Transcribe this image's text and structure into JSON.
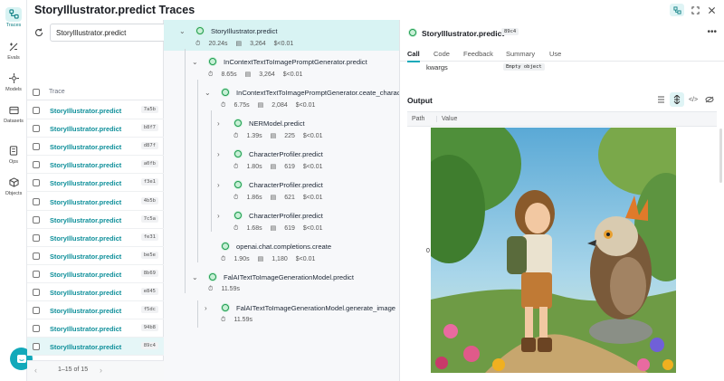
{
  "nav": [
    {
      "label": "Traces",
      "icon": "traces-icon"
    },
    {
      "label": "Evals",
      "icon": "evals-icon"
    },
    {
      "label": "Models",
      "icon": "models-icon"
    },
    {
      "label": "Datasets",
      "icon": "datasets-icon"
    },
    {
      "label": "Ops",
      "icon": "ops-icon"
    },
    {
      "label": "Objects",
      "icon": "objects-icon"
    }
  ],
  "page_title": "StoryIllustrator.predict Traces",
  "search_value": "StoryIllustrator.predict",
  "list_header": "Trace",
  "traces": [
    {
      "name": "StoryIllustrator.predict",
      "id": "7a5b"
    },
    {
      "name": "StoryIllustrator.predict",
      "id": "b8f7"
    },
    {
      "name": "StoryIllustrator.predict",
      "id": "d87f"
    },
    {
      "name": "StoryIllustrator.predict",
      "id": "a0fb"
    },
    {
      "name": "StoryIllustrator.predict",
      "id": "f3e1"
    },
    {
      "name": "StoryIllustrator.predict",
      "id": "4b5b"
    },
    {
      "name": "StoryIllustrator.predict",
      "id": "7c5a"
    },
    {
      "name": "StoryIllustrator.predict",
      "id": "fe31"
    },
    {
      "name": "StoryIllustrator.predict",
      "id": "be5e"
    },
    {
      "name": "StoryIllustrator.predict",
      "id": "8b69"
    },
    {
      "name": "StoryIllustrator.predict",
      "id": "e845"
    },
    {
      "name": "StoryIllustrator.predict",
      "id": "f5dc"
    },
    {
      "name": "StoryIllustrator.predict",
      "id": "94b8"
    },
    {
      "name": "StoryIllustrator.predict",
      "id": "89c4"
    }
  ],
  "pager": {
    "text": "1–15 of 15"
  },
  "tree": [
    {
      "name": "StoryIllustrator.predict",
      "time": "20.24s",
      "tokens": "3,264",
      "cost": "$<0.01"
    },
    {
      "name": "InContextTextToImagePromptGenerator.predict",
      "time": "8.65s",
      "tokens": "3,264",
      "cost": "$<0.01"
    },
    {
      "name": "InContextTextToImagePromptGenerator.ceate_character_profiles",
      "time": "6.75s",
      "tokens": "2,084",
      "cost": "$<0.01"
    },
    {
      "name": "NERModel.predict",
      "time": "1.39s",
      "tokens": "225",
      "cost": "$<0.01"
    },
    {
      "name": "CharacterProfiler.predict",
      "time": "1.80s",
      "tokens": "619",
      "cost": "$<0.01"
    },
    {
      "name": "CharacterProfiler.predict",
      "time": "1.86s",
      "tokens": "621",
      "cost": "$<0.01"
    },
    {
      "name": "CharacterProfiler.predict",
      "time": "1.68s",
      "tokens": "619",
      "cost": "$<0.01"
    },
    {
      "name": "openai.chat.completions.create",
      "time": "1.90s",
      "tokens": "1,180",
      "cost": "$<0.01"
    },
    {
      "name": "FalAITextToImageGenerationModel.predict",
      "time": "11.59s"
    },
    {
      "name": "FalAITextToImageGenerationModel.generate_image",
      "time": "11.59s"
    }
  ],
  "detail": {
    "title": "StoryIllustrator.predict",
    "id": "89c4",
    "tabs": [
      "Call",
      "Code",
      "Feedback",
      "Summary",
      "Use"
    ],
    "kwargs_key": "kwargs",
    "kwargs_value": "Empty object",
    "output_title": "Output",
    "col_path": "Path",
    "col_value": "Value",
    "row_key": "0"
  },
  "colors": {
    "accent": "#13a9ba",
    "link": "#0e8f9a",
    "selected": "#e5f6f7"
  }
}
